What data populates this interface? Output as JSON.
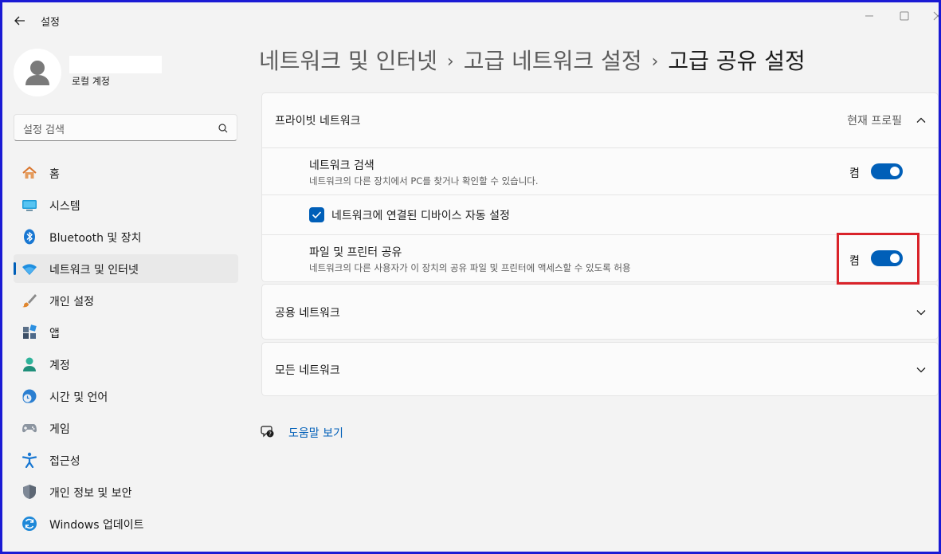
{
  "window": {
    "title": "설정"
  },
  "account": {
    "type": "로컬 계정"
  },
  "search": {
    "placeholder": "설정 검색"
  },
  "sidebar": {
    "items": [
      {
        "label": "홈",
        "icon": "home-icon"
      },
      {
        "label": "시스템",
        "icon": "system-icon"
      },
      {
        "label": "Bluetooth 및 장치",
        "icon": "bluetooth-icon"
      },
      {
        "label": "네트워크 및 인터넷",
        "icon": "wifi-icon",
        "active": true
      },
      {
        "label": "개인 설정",
        "icon": "brush-icon"
      },
      {
        "label": "앱",
        "icon": "apps-icon"
      },
      {
        "label": "계정",
        "icon": "account-icon"
      },
      {
        "label": "시간 및 언어",
        "icon": "clock-globe-icon"
      },
      {
        "label": "게임",
        "icon": "gamepad-icon"
      },
      {
        "label": "접근성",
        "icon": "accessibility-icon"
      },
      {
        "label": "개인 정보 및 보안",
        "icon": "shield-icon"
      },
      {
        "label": "Windows 업데이트",
        "icon": "update-icon"
      }
    ]
  },
  "breadcrumb": {
    "items": [
      "네트워크 및 인터넷",
      "고급 네트워크 설정",
      "고급 공유 설정"
    ],
    "separator": "›"
  },
  "private_network": {
    "title": "프라이빗 네트워크",
    "status": "현재 프로필",
    "network_discovery": {
      "title": "네트워크 검색",
      "description": "네트워크의 다른 장치에서 PC를 찾거나 확인할 수 있습니다.",
      "state_label": "켬",
      "on": true
    },
    "auto_setup": {
      "label": "네트워크에 연결된 디바이스 자동 설정",
      "checked": true
    },
    "file_printer_sharing": {
      "title": "파일 및 프린터 공유",
      "description": "네트워크의 다른 사용자가 이 장치의 공유 파일 및 프린터에 액세스할 수 있도록 허용",
      "state_label": "켬",
      "on": true
    }
  },
  "public_network": {
    "title": "공용 네트워크"
  },
  "all_networks": {
    "title": "모든 네트워크"
  },
  "help": {
    "label": "도움말 보기"
  },
  "colors": {
    "accent": "#005fb8",
    "highlight_border": "#d9232a",
    "frame_border": "#1a1ad4"
  }
}
